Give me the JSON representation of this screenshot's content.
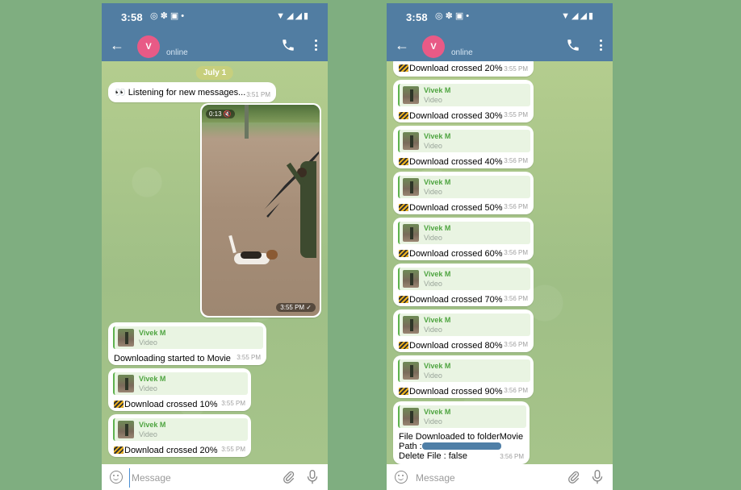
{
  "left": {
    "status_time": "3:58",
    "chat": {
      "avatar_letter": "V",
      "status": "online"
    },
    "date_pill": "July 1",
    "listen_msg": {
      "text": "👀 Listening for new messages...",
      "time": "3:51 PM"
    },
    "video": {
      "duration": "0:13 🔇",
      "time": "3:55 PM ✓"
    },
    "messages": [
      {
        "name": "Vivek M",
        "type": "Video",
        "text": "Downloading started to Movie",
        "time": "3:55 PM",
        "icon": false
      },
      {
        "name": "Vivek M",
        "type": "Video",
        "text": "Download crossed 10%",
        "time": "3:55 PM",
        "icon": true
      },
      {
        "name": "Vivek M",
        "type": "Video",
        "text": "Download crossed 20%",
        "time": "3:55 PM",
        "icon": true
      }
    ],
    "composer_placeholder": "Message"
  },
  "right": {
    "status_time": "3:58",
    "chat": {
      "avatar_letter": "V",
      "status": "online"
    },
    "top_partial": {
      "text": "Download crossed 20%",
      "time": "3:55 PM"
    },
    "messages": [
      {
        "name": "Vivek M",
        "type": "Video",
        "text": "Download crossed 30%",
        "time": "3:55 PM"
      },
      {
        "name": "Vivek M",
        "type": "Video",
        "text": "Download crossed 40%",
        "time": "3:56 PM"
      },
      {
        "name": "Vivek M",
        "type": "Video",
        "text": "Download crossed 50%",
        "time": "3:56 PM"
      },
      {
        "name": "Vivek M",
        "type": "Video",
        "text": "Download crossed 60%",
        "time": "3:56 PM"
      },
      {
        "name": "Vivek M",
        "type": "Video",
        "text": "Download crossed 70%",
        "time": "3:56 PM"
      },
      {
        "name": "Vivek M",
        "type": "Video",
        "text": "Download crossed 80%",
        "time": "3:56 PM"
      },
      {
        "name": "Vivek M",
        "type": "Video",
        "text": "Download crossed 90%",
        "time": "3:56 PM"
      }
    ],
    "final": {
      "name": "Vivek M",
      "type": "Video",
      "line1": "File Downloaded to folderMovie",
      "line2": "Path :",
      "line3": "Delete File : false",
      "time": "3:56 PM"
    },
    "composer_placeholder": "Message"
  }
}
